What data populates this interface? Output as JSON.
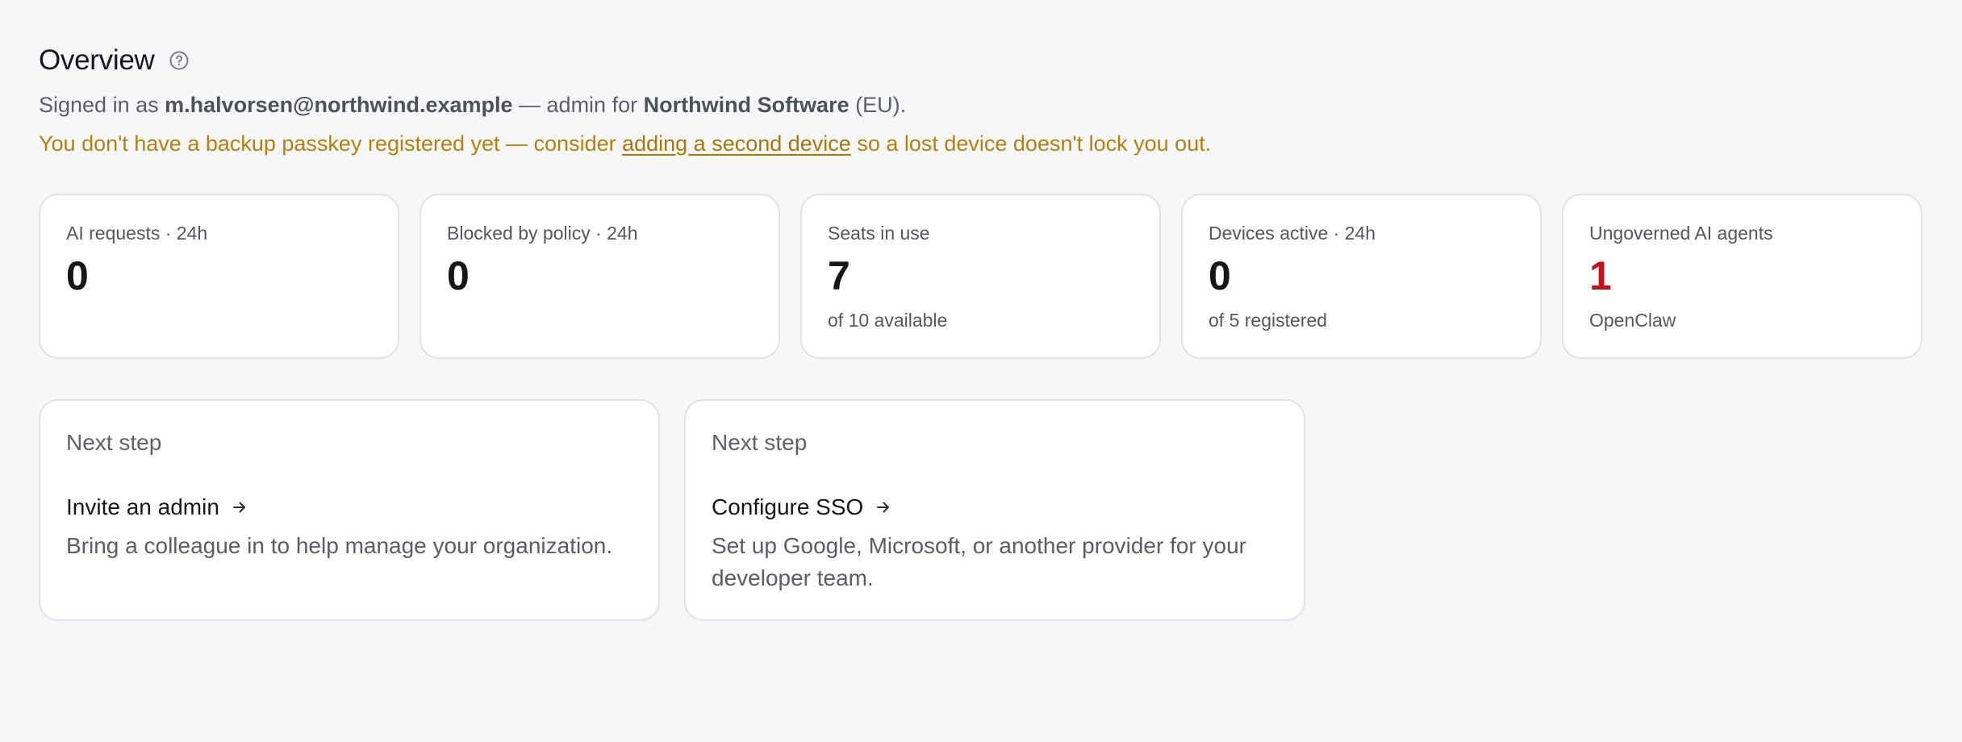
{
  "header": {
    "title": "Overview",
    "help_icon": "question-circle-icon",
    "signed_in_prefix": "Signed in as ",
    "user_email": "m.halvorsen@northwind.example",
    "role_text": " — admin for ",
    "org_name": "Northwind Software",
    "region_text": " (EU)."
  },
  "warning": {
    "prefix": "You don't have a backup passkey registered yet — consider ",
    "link_text": "adding a second device",
    "suffix": " so a lost device doesn't lock you out.",
    "color": "#b5800d"
  },
  "stats": [
    {
      "label": "AI requests · 24h",
      "value": "0",
      "sub": ""
    },
    {
      "label": "Blocked by policy · 24h",
      "value": "0",
      "sub": ""
    },
    {
      "label": "Seats in use",
      "value": "7",
      "sub": "of 10 available"
    },
    {
      "label": "Devices active · 24h",
      "value": "0",
      "sub": "of 5 registered"
    },
    {
      "label": "Ungoverned AI agents",
      "value": "1",
      "sub": "OpenClaw",
      "value_color": "#c0121b"
    }
  ],
  "next_steps": [
    {
      "kicker": "Next step",
      "title": "Invite an admin",
      "icon": "arrow-right-icon",
      "description": "Bring a colleague in to help manage your organization."
    },
    {
      "kicker": "Next step",
      "title": "Configure SSO",
      "icon": "arrow-right-icon",
      "description": "Set up Google, Microsoft, or another provider for your developer team."
    }
  ]
}
